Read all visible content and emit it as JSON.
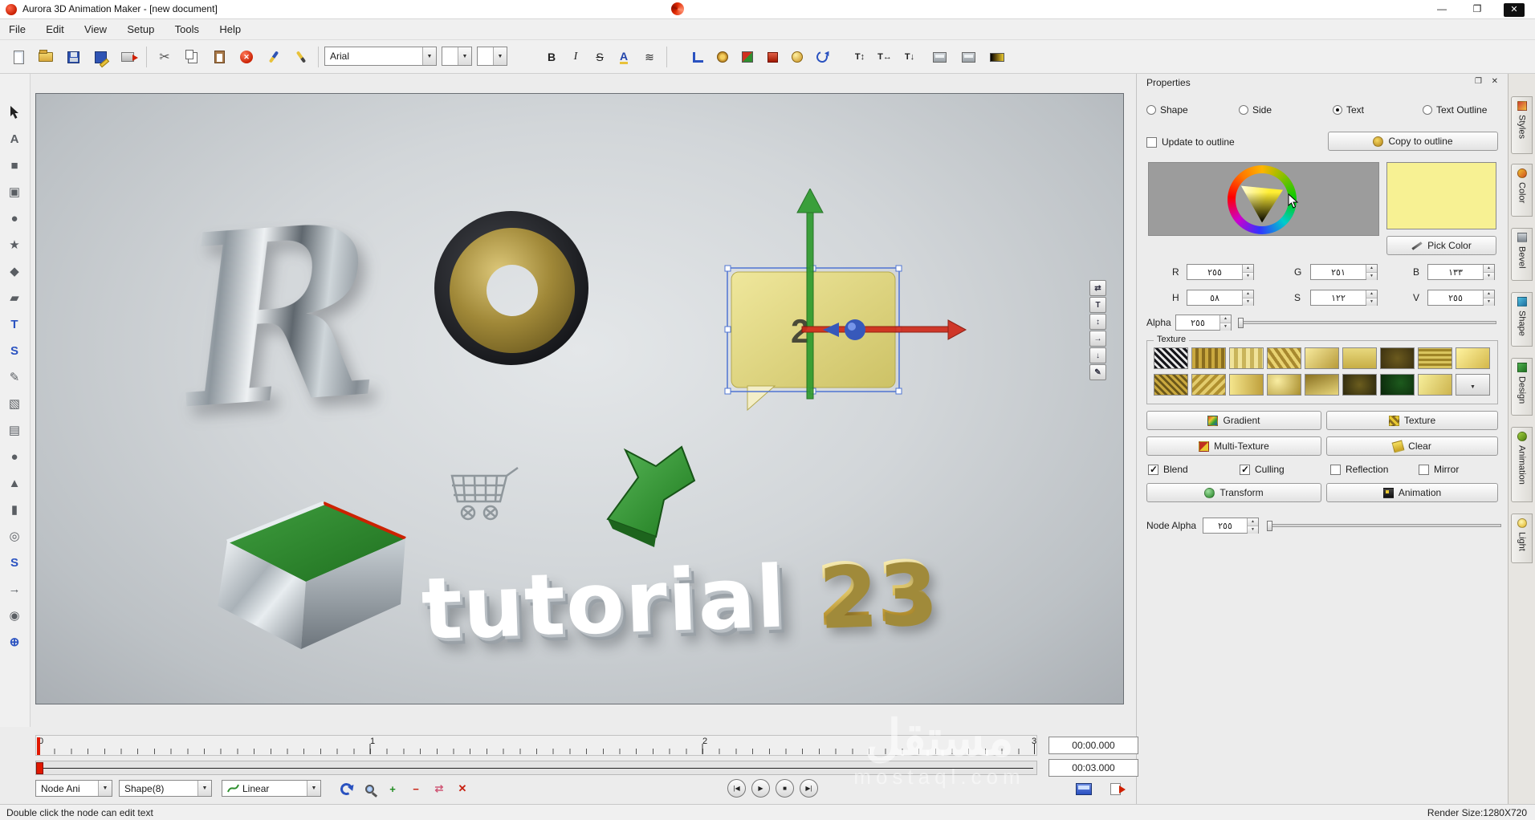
{
  "window": {
    "title": "Aurora 3D Animation Maker - [new document]",
    "minimize_glyph": "—",
    "maximize_glyph": "❐",
    "close_glyph": "✕"
  },
  "menu": {
    "items": [
      "File",
      "Edit",
      "View",
      "Setup",
      "Tools",
      "Help"
    ]
  },
  "toolbar": {
    "font_name": "Arial",
    "bold_label": "B",
    "italic_label": "I",
    "strike_label": "S",
    "fontcolor_label": "A",
    "effects_glyph": "≋",
    "text_vertical_glyph": "T↕",
    "text_horizontal_glyph": "T↔",
    "text_down_glyph": "T↓"
  },
  "left_tools": {
    "glyphs": [
      "",
      "A",
      "■",
      "▣",
      "●",
      "★",
      "◆",
      "▰",
      "T",
      "S",
      "✎",
      "▧",
      "▤",
      "●",
      "▲",
      "▮",
      "◎",
      "S",
      "→",
      "◉",
      "⊕"
    ]
  },
  "canvas": {
    "letter_r": "R",
    "bubble_text": "2",
    "tutorial_word": "tutorial ",
    "tutorial_number": "23",
    "gizmo_buttons": [
      "⇄",
      "T",
      "↕",
      "→",
      "↓",
      "✎"
    ],
    "watermark_line1": "مستقل",
    "watermark_line2": "mostaql.com"
  },
  "properties": {
    "title": "Properties",
    "radio_shape": "Shape",
    "radio_side": "Side",
    "radio_text": "Text",
    "radio_text_outline": "Text Outline",
    "update_to_outline": "Update to outline",
    "copy_to_outline": "Copy to outline",
    "pick_color": "Pick Color",
    "labels": {
      "r": "R",
      "g": "G",
      "b": "B",
      "h": "H",
      "s": "S",
      "v": "V",
      "alpha": "Alpha",
      "texture": "Texture",
      "node_alpha": "Node Alpha"
    },
    "values": {
      "r": "٢٥٥",
      "g": "٢٥١",
      "b": "١٣٣",
      "h": "٥٨",
      "s": "١٢٢",
      "v": "٢٥٥",
      "alpha": "٢٥٥",
      "node_alpha": "٢٥٥"
    },
    "swatch_color": "#f7f193",
    "btn_gradient": "Gradient",
    "btn_texture": "Texture",
    "btn_multi_texture": "Multi-Texture",
    "btn_clear": "Clear",
    "cb_blend": "Blend",
    "cb_culling": "Culling",
    "cb_reflection": "Reflection",
    "cb_mirror": "Mirror",
    "btn_transform": "Transform",
    "btn_animation": "Animation"
  },
  "side_tabs": {
    "items": [
      "Styles",
      "Color",
      "Bevel",
      "Shape",
      "Design",
      "Animation",
      "Light"
    ]
  },
  "timeline": {
    "ruler_numbers": [
      "0",
      "1",
      "2",
      "3"
    ],
    "current_time": "00:00.000",
    "end_time": "00:03.000",
    "combo_node": "Node Ani",
    "combo_shape": "Shape(8)",
    "combo_interp": "Linear",
    "playback": [
      "|◀",
      "▶",
      "■",
      "▶|"
    ]
  },
  "status": {
    "left": "Double click the node can edit text",
    "right": "Render Size:1280X720"
  },
  "icons": {
    "float_glyph": "❐",
    "close_glyph": "✕",
    "dropdown_glyph": "▼"
  },
  "colors": {
    "selection_blue": "#4f74d2",
    "gizmo_green": "#2e9b2e",
    "gizmo_red": "#cf2a1b",
    "gizmo_blue": "#2a4fc0",
    "swatch_yellow": "#f7f193"
  }
}
